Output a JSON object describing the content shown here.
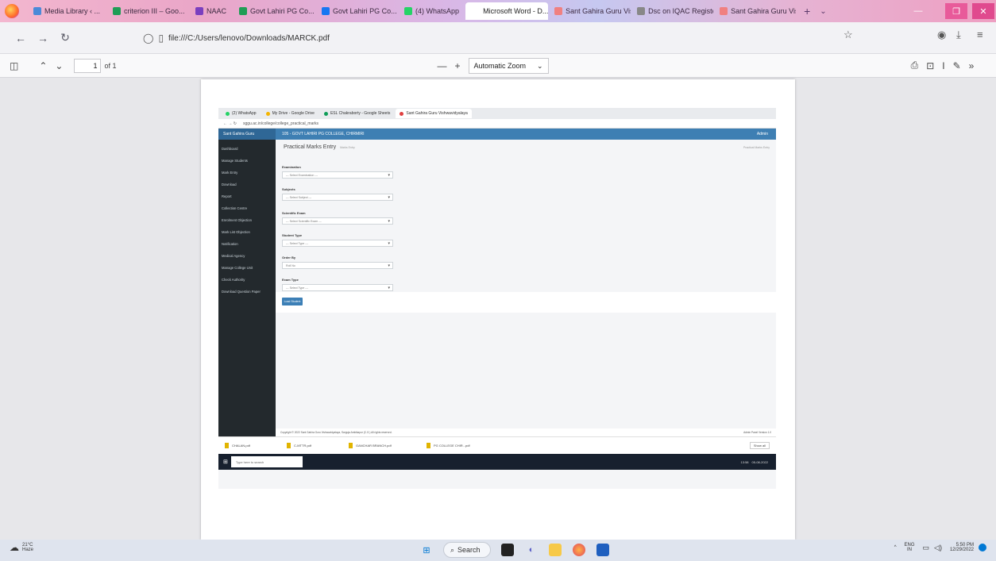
{
  "browser": {
    "tabs": [
      {
        "label": "Media Library ‹ ...",
        "color": "#4b8ad8"
      },
      {
        "label": "criterion III – Goo...",
        "color": "#1f9d55"
      },
      {
        "label": "NAAC",
        "color": "#7a3fbf"
      },
      {
        "label": "Govt Lahiri PG Co...",
        "color": "#1f9d55"
      },
      {
        "label": "Govt Lahiri PG Co...",
        "color": "#1877f2"
      },
      {
        "label": "(4) WhatsApp",
        "color": "#25d366"
      },
      {
        "label": "Microsoft Word - D...",
        "color": "#ffffff"
      },
      {
        "label": "Sant Gahira Guru Vis...",
        "color": "#f08080"
      },
      {
        "label": "Dsc on IQAC Register",
        "color": "#888888"
      },
      {
        "label": "Sant Gahira Guru Vis...",
        "color": "#f08080"
      }
    ],
    "url": "file:///C:/Users/lenovo/Downloads/MARCK.pdf"
  },
  "pdf": {
    "page_current": "1",
    "page_total": "of 1",
    "zoom": "Automatic Zoom"
  },
  "inner": {
    "tabs": [
      "(2) WhatsApp",
      "My Drive - Google Drive",
      "ESL Chakraborty - Google Sheets",
      "Sant Gahira Guru Vishwavidyalaya"
    ],
    "url": "sggu.ac.in/college/college_practical_marks",
    "brand": "Sant Gahira Guru",
    "college": "105 - GOVT LAHIRI PG COLLEGE, CHIRMIRI",
    "admin": "Admin",
    "sidebar": [
      "Dashboard",
      "Manage Students",
      "Mark Entry",
      "Download",
      "Report",
      "Collection Centre",
      "Enrolment Objection",
      "Mark List Objection",
      "Notification",
      "Medical Agency",
      "Manage College Unit",
      "Check Authority",
      "Download Question Paper"
    ],
    "page_title": "Practical Marks Entry",
    "page_subtitle": "Marks Entry",
    "breadcrumb": "Practical Marks Entry",
    "form": {
      "examination_label": "Examination",
      "examination_value": "--- Select Examination ---",
      "subject_label": "Subjects",
      "subject_value": "--- Select Subject ---",
      "scientific_label": "Scientific Exam",
      "scientific_value": "--- Select Scientific Exam ---",
      "student_type_label": "Student Type",
      "student_type_value": "--- Select Type ---",
      "order_by_label": "Order By",
      "order_by_value": "Roll No",
      "exam_type_label": "Exam Type",
      "exam_type_value": "--- Select Type ---",
      "submit": "Load Student"
    },
    "footer_left": "Copyright © 2022 Sant Gahira Guru Vishwavidyalaya, Sarguja Ambikapur (C.G.) All rights reserved.",
    "footer_right": "Admin Panel Version 1.0",
    "downloads": [
      "CHALAN.pdf",
      "C-MTTR.pdf",
      "GANCHAR BRANCH.pdf",
      "PG COLLEGE CHIR...pdf"
    ],
    "show_all": "Show all",
    "task_search": "Type here to search",
    "task_time": "13:58",
    "task_date": "05-08-2022"
  },
  "taskbar": {
    "weather_temp": "21°C",
    "weather_text": "Haze",
    "search": "Search",
    "lang": "ENG",
    "region": "IN",
    "time": "5:50 PM",
    "date": "12/29/2022"
  }
}
